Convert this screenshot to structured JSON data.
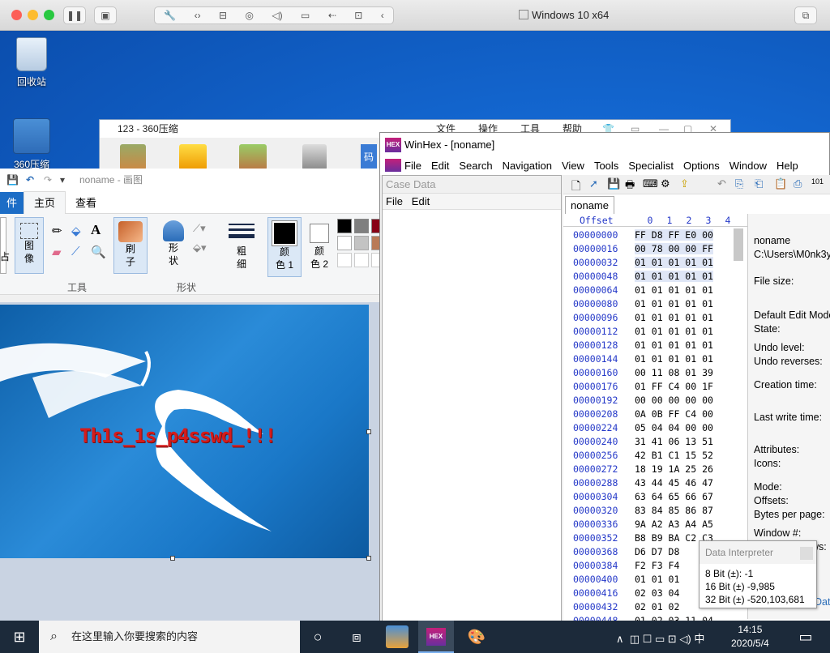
{
  "vm": {
    "title": "Windows 10 x64"
  },
  "desktop": {
    "icons": [
      {
        "label": "回收站"
      },
      {
        "label": "360压缩"
      }
    ]
  },
  "zip": {
    "title": "123 - 360压缩",
    "menu": [
      "文件",
      "操作",
      "工具",
      "帮助"
    ],
    "extra": "码"
  },
  "paint": {
    "title": "noname - 画图",
    "tabs": [
      "件",
      "主页",
      "查看"
    ],
    "groups": {
      "image": "图\n像",
      "tools_label": "工具",
      "brush": "刷\n子",
      "shapes": "形\n状",
      "shapes_label": "形状",
      "size": "粗\n细",
      "color1": "颜\n色 1",
      "color2": "颜\n色 2",
      "left_cut": "占"
    },
    "password_text": "Th1s_1s_p4sswd_!!!"
  },
  "winhex": {
    "title": "WinHex - [noname]",
    "menu": [
      "File",
      "Edit",
      "Search",
      "Navigation",
      "View",
      "Tools",
      "Specialist",
      "Options",
      "Window",
      "Help"
    ],
    "case_pane": {
      "title": "Case Data",
      "menu": [
        "File",
        "Edit"
      ]
    },
    "tab": "noname",
    "header": {
      "offset": "Offset",
      "cols": [
        "0",
        "1",
        "2",
        "3",
        "4"
      ]
    },
    "rows": [
      {
        "off": "00000000",
        "b": "FF D8 FF E0 00"
      },
      {
        "off": "00000016",
        "b": "00 78 00 00 FF"
      },
      {
        "off": "00000032",
        "b": "01 01 01 01 01"
      },
      {
        "off": "00000048",
        "b": "01 01 01 01 01"
      },
      {
        "off": "00000064",
        "b": "01 01 01 01 01"
      },
      {
        "off": "00000080",
        "b": "01 01 01 01 01"
      },
      {
        "off": "00000096",
        "b": "01 01 01 01 01"
      },
      {
        "off": "00000112",
        "b": "01 01 01 01 01"
      },
      {
        "off": "00000128",
        "b": "01 01 01 01 01"
      },
      {
        "off": "00000144",
        "b": "01 01 01 01 01"
      },
      {
        "off": "00000160",
        "b": "00 11 08 01 39"
      },
      {
        "off": "00000176",
        "b": "01 FF C4 00 1F"
      },
      {
        "off": "00000192",
        "b": "00 00 00 00 00"
      },
      {
        "off": "00000208",
        "b": "0A 0B FF C4 00"
      },
      {
        "off": "00000224",
        "b": "05 04 04 00 00"
      },
      {
        "off": "00000240",
        "b": "31 41 06 13 51"
      },
      {
        "off": "00000256",
        "b": "42 B1 C1 15 52"
      },
      {
        "off": "00000272",
        "b": "18 19 1A 25 26"
      },
      {
        "off": "00000288",
        "b": "43 44 45 46 47"
      },
      {
        "off": "00000304",
        "b": "63 64 65 66 67"
      },
      {
        "off": "00000320",
        "b": "83 84 85 86 87"
      },
      {
        "off": "00000336",
        "b": "9A A2 A3 A4 A5"
      },
      {
        "off": "00000352",
        "b": "B8 B9 BA C2 C3"
      },
      {
        "off": "00000368",
        "b": "D6 D7 D8"
      },
      {
        "off": "00000384",
        "b": "F2 F3 F4"
      },
      {
        "off": "00000400",
        "b": "01 01 01"
      },
      {
        "off": "00000416",
        "b": "02 03 04"
      },
      {
        "off": "00000432",
        "b": "02 01 02"
      },
      {
        "off": "00000448",
        "b": "01 02 03 11 04"
      }
    ],
    "info": {
      "name": "noname",
      "path": "C:\\Users\\M0nk3y",
      "file_size": "File size:",
      "edit_mode": "Default Edit Mode",
      "state": "State:",
      "undo_level": "Undo level:",
      "undo_reverses": "Undo reverses:",
      "creation_time": "Creation time:",
      "last_write": "Last write time:",
      "attributes": "Attributes:",
      "icons": "Icons:",
      "mode": "Mode:",
      "offsets": "Offsets:",
      "bytes_per_page": "Bytes per page:",
      "window_num": "Window #:",
      "windows_cut": "ws:",
      "dat_cut": "Dat"
    }
  },
  "data_interpreter": {
    "title": "Data Interpreter",
    "lines": [
      "8 Bit (±): -1",
      "16 Bit (±) -9,985",
      "32 Bit (±) -520,103,681"
    ]
  },
  "taskbar": {
    "search_placeholder": "在这里输入你要搜索的内容",
    "ime": "中",
    "time": "14:15",
    "date": "2020/5/4",
    "winhex_label": "HEX"
  }
}
